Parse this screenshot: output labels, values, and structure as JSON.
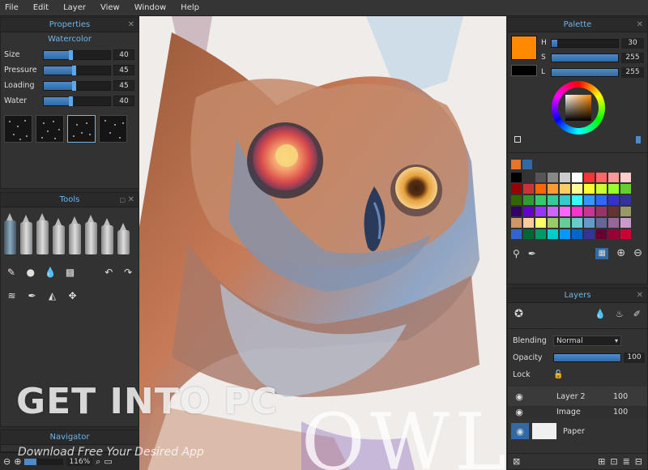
{
  "menu": [
    "File",
    "Edit",
    "Layer",
    "View",
    "Window",
    "Help"
  ],
  "properties": {
    "title": "Properties",
    "brush_name": "Watercolor",
    "rows": [
      {
        "label": "Size",
        "value": "40",
        "level": 0.4
      },
      {
        "label": "Pressure",
        "value": "45",
        "level": 0.45
      },
      {
        "label": "Loading",
        "value": "45",
        "level": 0.45
      },
      {
        "label": "Water",
        "value": "40",
        "level": 0.4
      }
    ]
  },
  "tools": {
    "title": "Tools"
  },
  "navigator": {
    "title": "Navigator",
    "zoom": "116%"
  },
  "palette": {
    "title": "Palette",
    "current_color": "#ff8a00",
    "secondary_color": "#000000",
    "h": {
      "label": "H",
      "value": "30",
      "level": 0.08
    },
    "s": {
      "label": "S",
      "value": "255",
      "level": 1.0
    },
    "l": {
      "label": "L",
      "value": "255",
      "level": 1.0
    }
  },
  "layers": {
    "title": "Layers",
    "blending_label": "Blending",
    "blending_value": "Normal",
    "opacity_label": "Opacity",
    "opacity_value": "100",
    "lock_label": "Lock",
    "items": [
      {
        "name": "Layer 2",
        "opacity": "100"
      },
      {
        "name": "Image",
        "opacity": "100"
      }
    ],
    "paper_label": "Paper"
  },
  "watermark": {
    "brand": "GET INTO PC",
    "tagline": "Download Free Your Desired App"
  },
  "canvas_text": "OWL?"
}
